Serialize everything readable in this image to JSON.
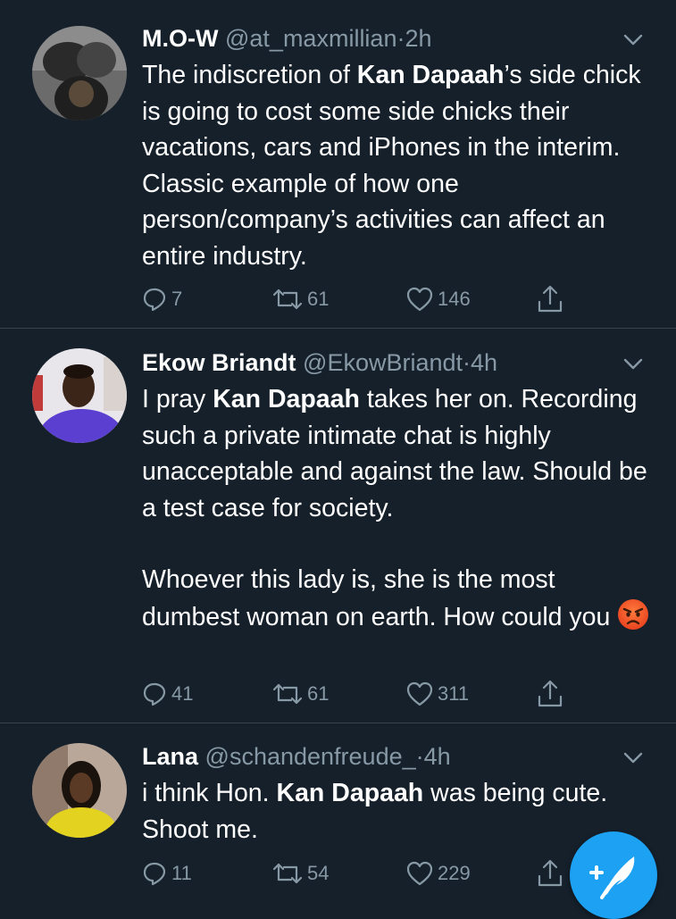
{
  "tweets": [
    {
      "name": "M.O-W",
      "handle": "@at_maxmillian",
      "separator": "·",
      "time": "2h",
      "text_before": "The indiscretion of ",
      "mention": "Kan Dapaah",
      "text_after": "’s side chick is going to cost some side chicks their vacations, cars and iPhones in the interim. Classic example of how one person/company’s activities can affect an entire industry.",
      "replies": "7",
      "retweets": "61",
      "likes": "146"
    },
    {
      "name": "Ekow Briandt",
      "handle": "@EkowBriandt",
      "separator": "·",
      "time": "4h",
      "text_before": "I pray ",
      "mention": "Kan Dapaah",
      "text_after": " takes her on. Recording such a private intimate chat is highly unacceptable and against the law. Should be a test case for society.",
      "paragraph2": "Whoever this lady is, she is the most dumbest woman on earth. How could you",
      "emoji": "angry-face-emoji",
      "replies": "41",
      "retweets": "61",
      "likes": "311"
    },
    {
      "name": "Lana",
      "handle": "@schandenfreude_",
      "separator": "·",
      "time": "4h",
      "text_before": "i think Hon. ",
      "mention": "Kan Dapaah",
      "text_after": " was being cute. Shoot me.",
      "replies": "11",
      "retweets": "54",
      "likes": "229"
    }
  ],
  "icons": {
    "reply": "reply-icon",
    "retweet": "retweet-icon",
    "like": "heart-icon",
    "share": "share-icon",
    "more": "chevron-down-icon",
    "compose": "compose-tweet-icon"
  },
  "colors": {
    "background": "#15202b",
    "divider": "#38444d",
    "secondary_text": "#8899a6",
    "accent": "#1da1f2"
  }
}
